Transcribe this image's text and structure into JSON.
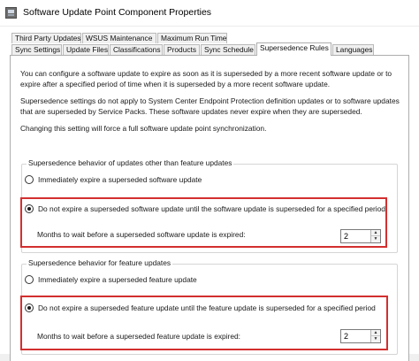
{
  "window": {
    "title": "Software Update Point Component Properties"
  },
  "tabs": {
    "row1": [
      {
        "label": "Third Party Updates"
      },
      {
        "label": "WSUS Maintenance"
      },
      {
        "label": "Maximum Run Time"
      }
    ],
    "row2": [
      {
        "label": "Sync Settings"
      },
      {
        "label": "Update Files"
      },
      {
        "label": "Classifications"
      },
      {
        "label": "Products"
      },
      {
        "label": "Sync Schedule"
      },
      {
        "label": "Supersedence Rules",
        "active": true
      },
      {
        "label": "Languages"
      }
    ]
  },
  "content": {
    "intro": "You can configure a software update to expire as soon as it is superseded by a more recent software update or to expire after a specified period of time when it is superseded by a more recent software update.",
    "note": "Supersedence settings do not apply to System Center Endpoint Protection definition updates or to software updates that are superseded by Service Packs. These software updates never expire when they are superseded.",
    "warning": "Changing this setting will force a full software update point synchronization."
  },
  "group_other": {
    "label": "Supersedence behavior of updates other than feature updates",
    "option_immediate": "Immediately expire a superseded software update",
    "option_wait": "Do not expire a superseded software update until the software update is superseded for a specified period",
    "months_label": "Months to wait before a superseded software update is expired:",
    "months_value": "2",
    "selected": "wait"
  },
  "group_feature": {
    "label": "Supersedence behavior for feature updates",
    "option_immediate": "Immediately expire a superseded feature update",
    "option_wait": "Do not expire a superseded feature update until the feature update is superseded for a specified period",
    "months_label": "Months to wait before a superseded feature update is expired:",
    "months_value": "2",
    "selected": "wait"
  },
  "colors": {
    "highlight": "#d32f2f",
    "window_bg": "#ffffff",
    "tab_bg": "#f0f0f0"
  },
  "icons": {
    "app": "app-icon",
    "spin_up": "spin-up-icon",
    "spin_down": "spin-down-icon"
  }
}
